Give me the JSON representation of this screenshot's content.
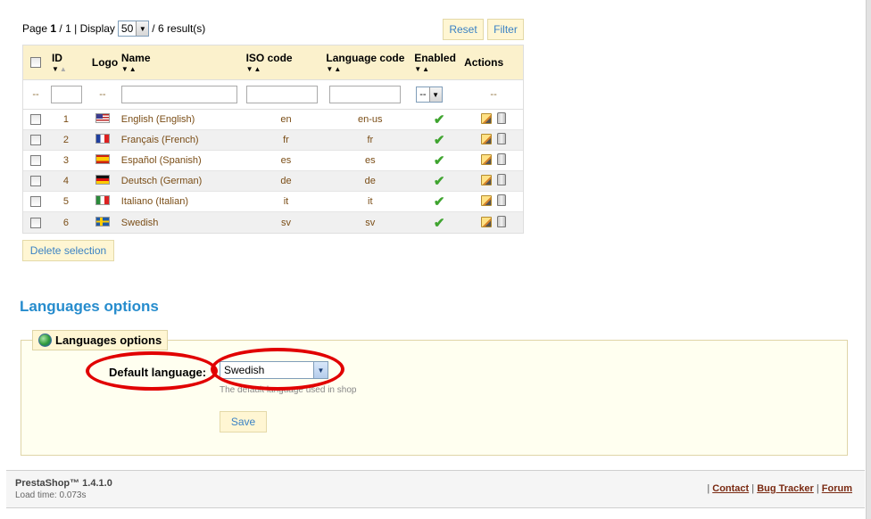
{
  "pagination": {
    "page_label": "Page",
    "current_page": "1",
    "total_pages": "/ 1",
    "separator": "|",
    "display_label": "Display",
    "per_page": "50",
    "results": "/ 6 result(s)"
  },
  "toolbar": {
    "reset_label": "Reset",
    "filter_label": "Filter"
  },
  "table": {
    "columns": {
      "id": "ID",
      "logo": "Logo",
      "name": "Name",
      "iso": "ISO code",
      "language_code": "Language code",
      "enabled": "Enabled",
      "actions": "Actions"
    },
    "filter": {
      "dash": "--",
      "enabled_select": "--"
    },
    "rows": [
      {
        "id": "1",
        "name": "English (English)",
        "iso": "en",
        "language_code": "en-us",
        "flag": "us"
      },
      {
        "id": "2",
        "name": "Français (French)",
        "iso": "fr",
        "language_code": "fr",
        "flag": "fr"
      },
      {
        "id": "3",
        "name": "Español (Spanish)",
        "iso": "es",
        "language_code": "es",
        "flag": "es"
      },
      {
        "id": "4",
        "name": "Deutsch (German)",
        "iso": "de",
        "language_code": "de",
        "flag": "de"
      },
      {
        "id": "5",
        "name": "Italiano (Italian)",
        "iso": "it",
        "language_code": "it",
        "flag": "it"
      },
      {
        "id": "6",
        "name": "Swedish",
        "iso": "sv",
        "language_code": "sv",
        "flag": "se"
      }
    ]
  },
  "delete_selection_label": "Delete selection",
  "options": {
    "section_title": "Languages options",
    "legend": "Languages options",
    "default_language_label": "Default language:",
    "default_language_value": "Swedish",
    "hint": "The default language used in shop",
    "save_label": "Save"
  },
  "footer": {
    "version": "PrestaShop™ 1.4.1.0",
    "load_time": "Load time: 0.073s",
    "sep": "|",
    "contact": "Contact",
    "bug_tracker": "Bug Tracker",
    "forum": "Forum"
  },
  "colors": {
    "accent_blue": "#268ccd",
    "header_yellow": "#fbf1cc",
    "annotation_red": "#e10000",
    "enabled_green": "#3fa42f"
  }
}
